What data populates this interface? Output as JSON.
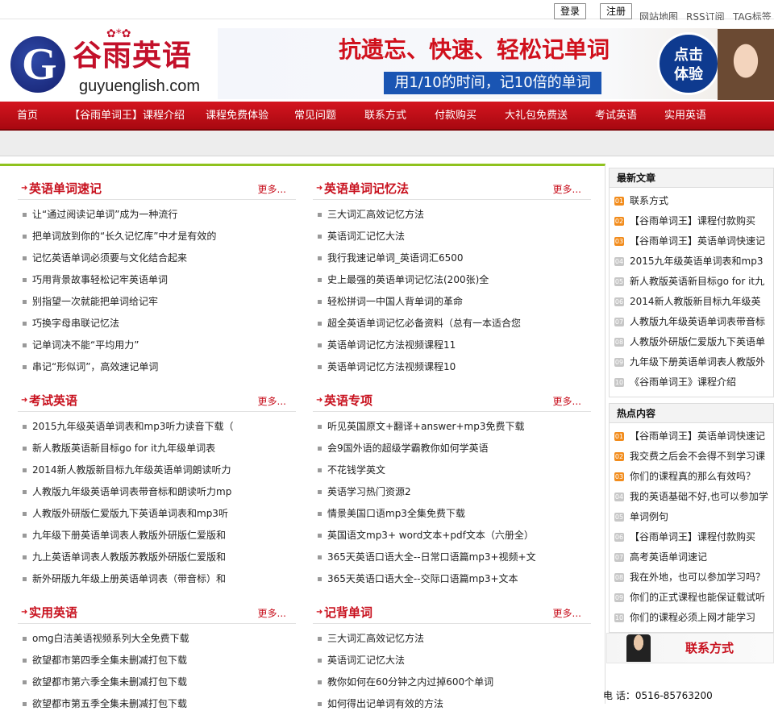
{
  "topbar": {
    "login": "登录",
    "register": "注册",
    "links": [
      "网站地图",
      "RSS订阅",
      "TAG标签"
    ]
  },
  "header": {
    "logo_cn": "谷雨英语",
    "logo_en": "guyuenglish.com",
    "banner_headline": "抗遗忘、快速、轻松记单词",
    "banner_sub": "用1/10的时间，记10倍的单词",
    "banner_cta": [
      "点击",
      "体验"
    ]
  },
  "nav": {
    "items": [
      "首页",
      "【谷雨单词王】课程介绍",
      "课程免费体验",
      "常见问题",
      "联系方式",
      "付款购买",
      "大礼包免费送",
      "考试英语",
      "实用英语"
    ]
  },
  "blocks": [
    {
      "title": "英语单词速记",
      "more": "更多...",
      "items": [
        "让“通过阅读记单词”成为一种流行",
        "把单词放到你的“长久记忆库”中才是有效的",
        "记忆英语单词必须要与文化结合起来",
        "巧用背景故事轻松记牢英语单词",
        "别指望一次就能把单词给记牢",
        "巧换字母串联记忆法",
        "记单词决不能“平均用力”",
        "串记“形似词”，高效速记单词"
      ]
    },
    {
      "title": "英语单词记忆法",
      "more": "更多...",
      "items": [
        "三大词汇高效记忆方法",
        "英语词汇记忆大法",
        "我行我速记单词_英语词汇6500",
        "史上最强的英语单词记忆法(200张)全",
        "轻松拼词一中国人背单词的革命",
        "超全英语单词记忆必备资料（总有一本适合您",
        "英语单词记忆方法视频课程11",
        "英语单词记忆方法视频课程10"
      ]
    },
    {
      "title": "考试英语",
      "more": "更多...",
      "items": [
        "2015九年级英语单词表和mp3听力读音下载（",
        "新人教版英语新目标go for it九年级单词表",
        "2014新人教版新目标九年级英语单词朗读听力",
        "人教版九年级英语单词表带音标和朗读听力mp",
        "人教版外研版仁爱版九下英语单词表和mp3听",
        "九年级下册英语单词表人教版外研版仁爱版和",
        "九上英语单词表人教版苏教版外研版仁爱版和",
        "新外研版九年级上册英语单词表（带音标）和"
      ]
    },
    {
      "title": "英语专项",
      "more": "更多...",
      "items": [
        "听见英国原文+翻译+answer+mp3免费下载",
        "会9国外语的超级学霸教你如何学英语",
        "不花钱学英文",
        "英语学习热门资源2",
        "情景美国口语mp3全集免费下载",
        "英国语文mp3+ word文本+pdf文本（六册全）",
        "365天英语口语大全--日常口语篇mp3+视频+文",
        "365天英语口语大全--交际口语篇mp3+文本"
      ]
    },
    {
      "title": "实用英语",
      "more": "更多...",
      "items": [
        "omg白洁美语视频系列大全免费下载",
        "欲望都市第四季全集未删减打包下载",
        "欲望都市第六季全集未删减打包下载",
        "欲望都市第五季全集未删减打包下载"
      ]
    },
    {
      "title": "记背单词",
      "more": "更多...",
      "items": [
        "三大词汇高效记忆方法",
        "英语词汇记忆大法",
        "教你如何在60分钟之内过掉600个单词",
        "如何得出记单词有效的方法"
      ]
    }
  ],
  "sidebar": {
    "latest": {
      "title": "最新文章",
      "items": [
        "联系方式",
        "【谷雨单词王】课程付款购买",
        "【谷雨单词王】英语单词快速记",
        "2015九年级英语单词表和mp3",
        "新人教版英语新目标go for it九",
        "2014新人教版新目标九年级英",
        "人教版九年级英语单词表带音标",
        "人教版外研版仁爱版九下英语单",
        "九年级下册英语单词表人教版外",
        "《谷雨单词王》课程介绍"
      ]
    },
    "hot": {
      "title": "热点内容",
      "items": [
        "【谷雨单词王】英语单词快速记",
        "我交费之后会不会得不到学习课",
        "你们的课程真的那么有效吗？",
        "我的英语基础不好,也可以参加学",
        "单词例句",
        "【谷雨单词王】课程付款购买",
        "高考英语单词速记",
        "我在外地，也可以参加学习吗？",
        "你们的正式课程也能保证载试听",
        "你们的课程必须上网才能学习"
      ]
    },
    "contact_title": "联系方式",
    "contact_tel": "电 话：0516-85763200"
  },
  "colors": {
    "brand_red": "#c8111e",
    "accent_green": "#8fc21e",
    "banner_blue": "#1a55b3"
  }
}
